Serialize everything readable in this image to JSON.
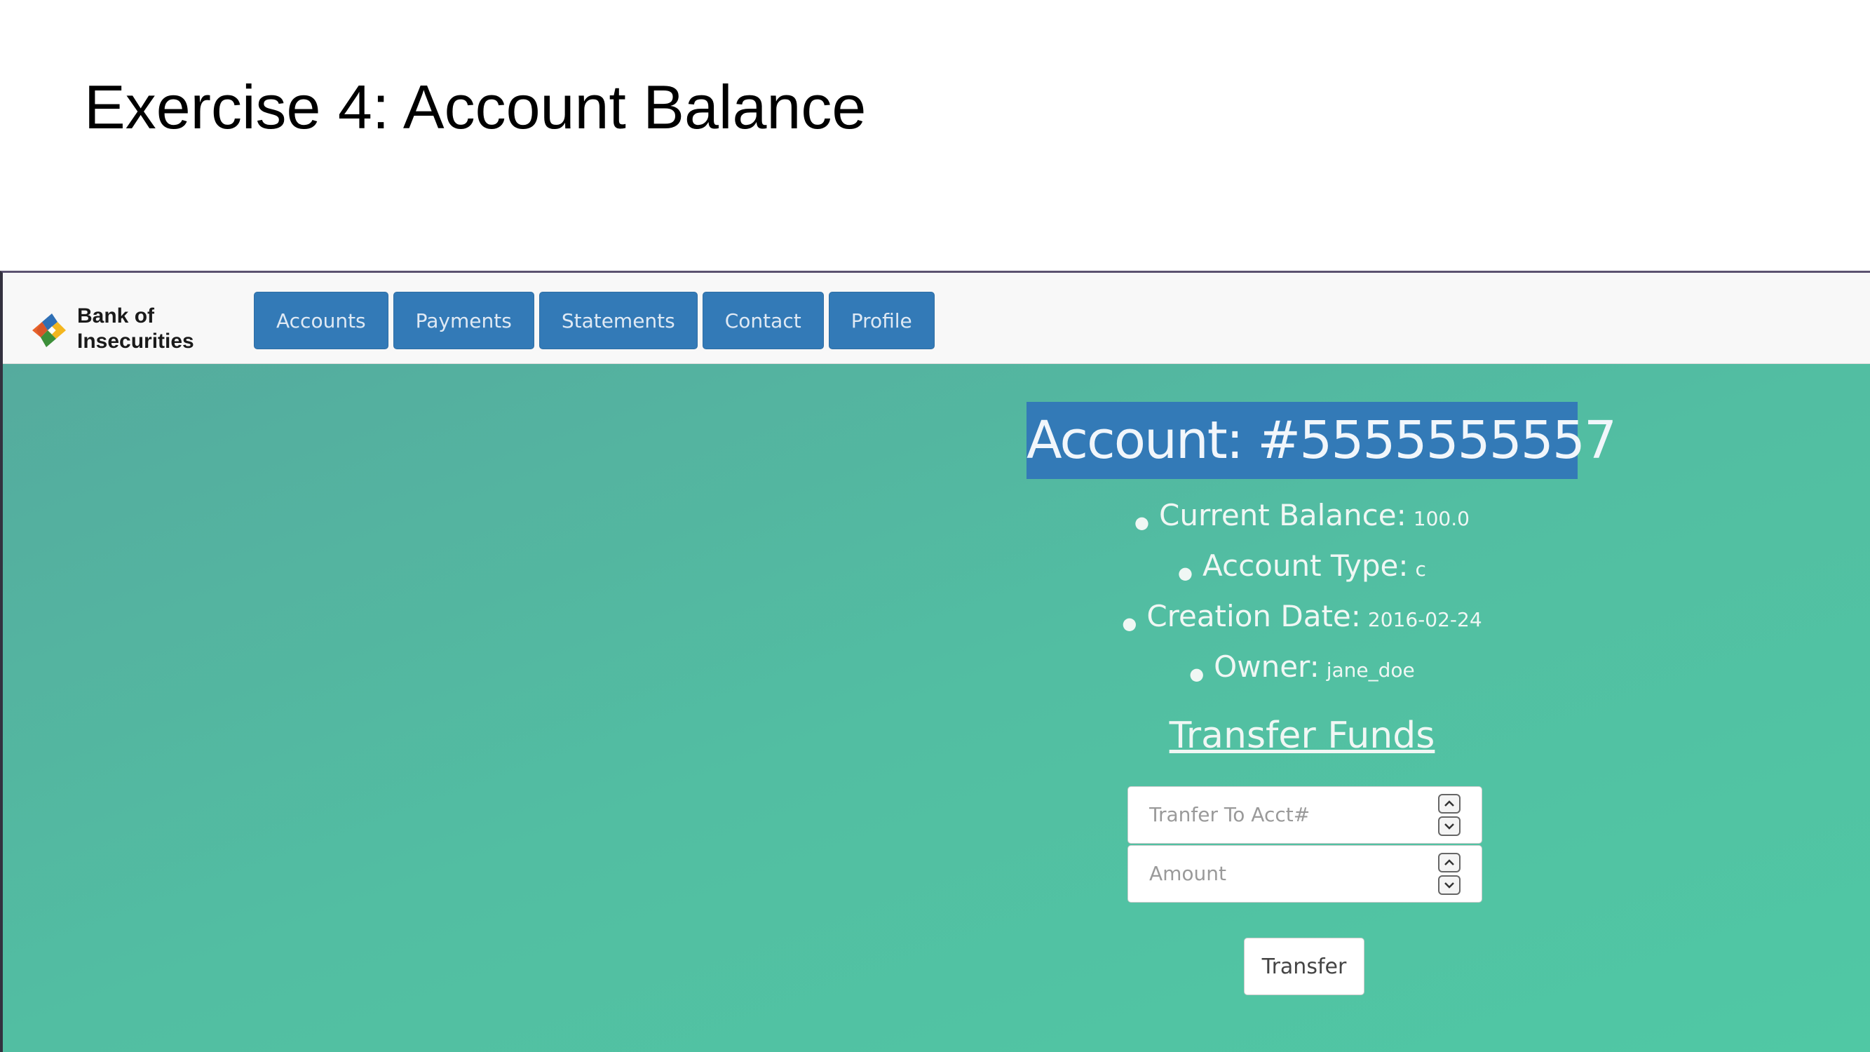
{
  "slide": {
    "title": "Exercise 4: Account Balance"
  },
  "brand": {
    "name": "Bank of\nInsecurities"
  },
  "nav": {
    "items": [
      {
        "label": "Accounts"
      },
      {
        "label": "Payments"
      },
      {
        "label": "Statements"
      },
      {
        "label": "Contact"
      },
      {
        "label": "Profile"
      }
    ]
  },
  "account": {
    "heading": "Account: #5555555557",
    "details": [
      {
        "label": "Current Balance:",
        "value": "100.0"
      },
      {
        "label": "Account Type:",
        "value": "c"
      },
      {
        "label": "Creation Date:",
        "value": "2016-02-24"
      },
      {
        "label": "Owner:",
        "value": "jane_doe"
      }
    ]
  },
  "transfer": {
    "heading": "Transfer Funds",
    "to_account_placeholder": "Tranfer To Acct#",
    "amount_placeholder": "Amount",
    "submit_label": "Transfer"
  },
  "colors": {
    "nav_button": "#337ab7",
    "heading_highlight": "#337ab7",
    "background_start": "#55ab9e",
    "background_end": "#50c8a4"
  },
  "icons": {
    "logo": "bank-logo-icon",
    "spinner_up": "chevron-up-icon",
    "spinner_down": "chevron-down-icon"
  }
}
